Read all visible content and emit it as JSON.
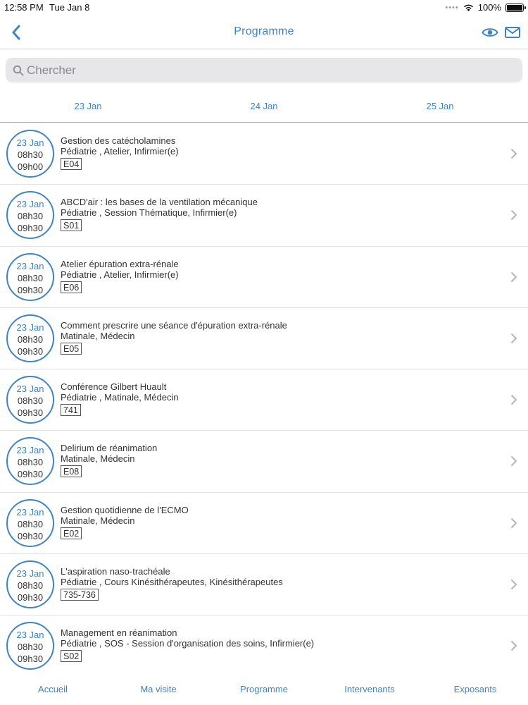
{
  "status_bar": {
    "time": "12:58 PM",
    "date": "Tue Jan 8",
    "battery": "100%"
  },
  "nav": {
    "title": "Programme",
    "back_icon": "chevron-left-icon",
    "eye_icon": "eye-icon",
    "mail_icon": "mail-icon"
  },
  "search": {
    "placeholder": "Chercher"
  },
  "days": [
    "23 Jan",
    "24 Jan",
    "25 Jan"
  ],
  "sessions": [
    {
      "date": "23 Jan",
      "start": "08h30",
      "end": "09h00",
      "title": "Gestion des catécholamines",
      "tags": "Pédiatrie , Atelier, Infirmier(e)",
      "room": "E04"
    },
    {
      "date": "23 Jan",
      "start": "08h30",
      "end": "09h30",
      "title": "ABCD'air : les bases de la ventilation mécanique",
      "tags": "Pédiatrie , Session Thématique, Infirmier(e)",
      "room": "S01"
    },
    {
      "date": "23 Jan",
      "start": "08h30",
      "end": "09h30",
      "title": "Atelier épuration extra-rénale",
      "tags": "Pédiatrie , Atelier, Infirmier(e)",
      "room": "E06"
    },
    {
      "date": "23 Jan",
      "start": "08h30",
      "end": "09h30",
      "title": "Comment prescrire une séance d'épuration extra-rénale",
      "tags": "Matinale, Médecin",
      "room": "E05"
    },
    {
      "date": "23 Jan",
      "start": "08h30",
      "end": "09h30",
      "title": "Conférence Gilbert Huault",
      "tags": "Pédiatrie , Matinale, Médecin",
      "room": "741"
    },
    {
      "date": "23 Jan",
      "start": "08h30",
      "end": "09h30",
      "title": "Delirium de réanimation",
      "tags": "Matinale, Médecin",
      "room": "E08"
    },
    {
      "date": "23 Jan",
      "start": "08h30",
      "end": "09h30",
      "title": "Gestion quotidienne de l'ECMO",
      "tags": "Matinale, Médecin",
      "room": "E02"
    },
    {
      "date": "23 Jan",
      "start": "08h30",
      "end": "09h30",
      "title": "L'aspiration naso-trachéale",
      "tags": "Pédiatrie , Cours Kinésithérapeutes, Kinésithérapeutes",
      "room": "735-736"
    },
    {
      "date": "23 Jan",
      "start": "08h30",
      "end": "09h30",
      "title": "Management en réanimation",
      "tags": "Pédiatrie , SOS - Session d'organisation des soins, Infirmier(e)",
      "room": "S02"
    }
  ],
  "tabs": [
    "Accueil",
    "Ma visite",
    "Programme",
    "Intervenants",
    "Exposants"
  ],
  "colors": {
    "accent": "#3f84c1",
    "divider": "#e0e0e0",
    "search_bg": "#e7e7ea"
  }
}
